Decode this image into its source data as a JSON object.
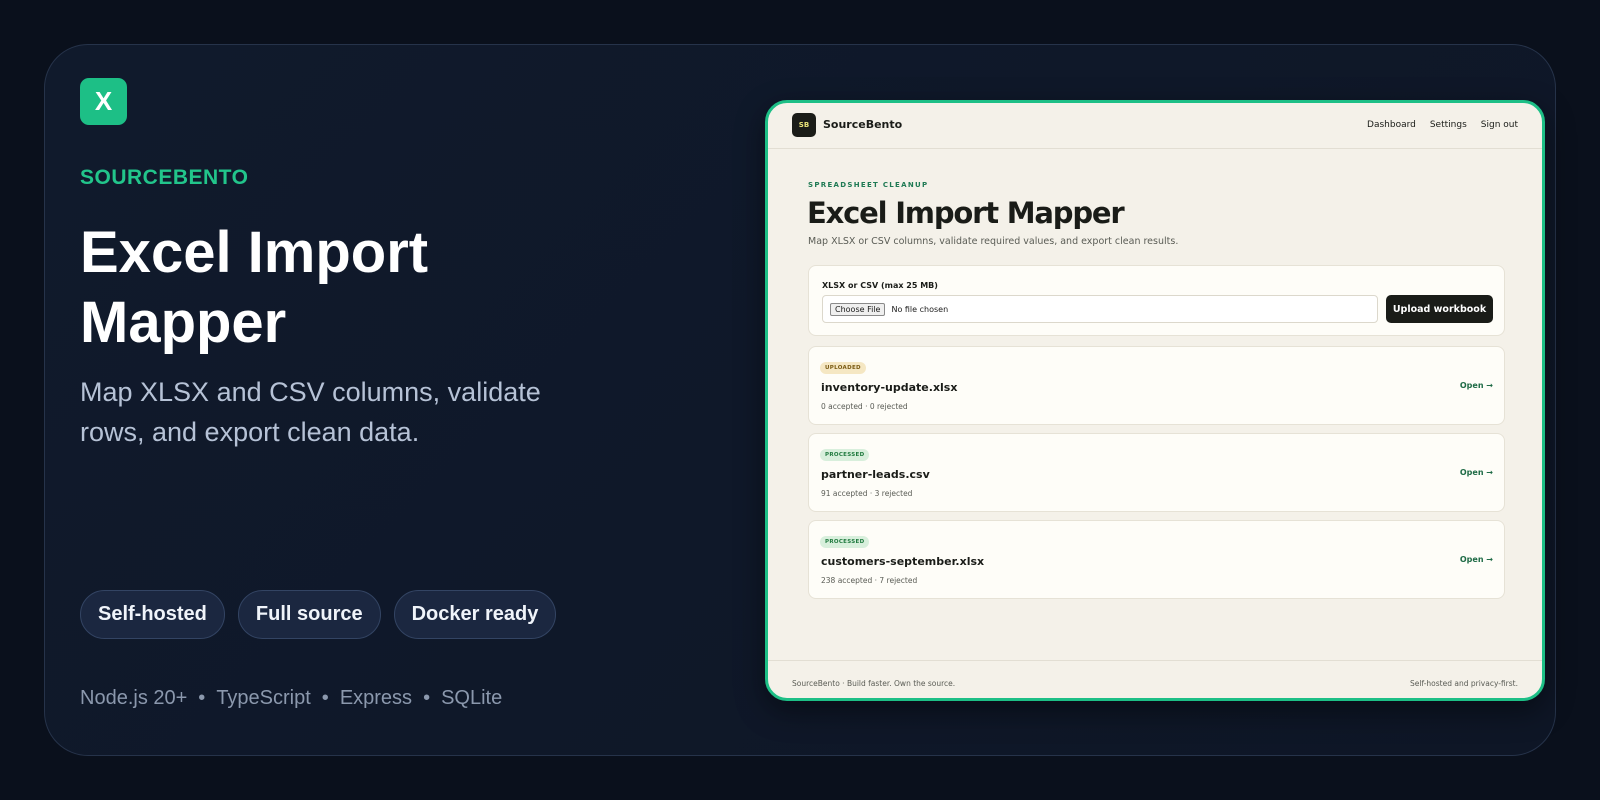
{
  "promo": {
    "logo_letter": "X",
    "brand": "SOURCEBENTO",
    "title": "Excel Import Mapper",
    "subtitle": "Map XLSX and CSV columns, validate rows, and export clean data.",
    "chips": [
      "Self-hosted",
      "Full source",
      "Docker ready"
    ],
    "stack": [
      "Node.js 20+",
      "TypeScript",
      "Express",
      "SQLite"
    ],
    "stack_separator": "•",
    "accent_color": "#22c58b"
  },
  "app": {
    "logo_text": "SB",
    "name": "SourceBento",
    "nav": [
      "Dashboard",
      "Settings",
      "Sign out"
    ],
    "eyebrow": "SPREADSHEET CLEANUP",
    "title": "Excel Import Mapper",
    "subtitle": "Map XLSX or CSV columns, validate required values, and export clean results.",
    "upload": {
      "label": "XLSX or CSV (max 25 MB)",
      "choose_label": "Choose File",
      "no_file": "No file chosen",
      "button": "Upload workbook"
    },
    "files": [
      {
        "status": "UPLOADED",
        "name": "inventory-update.xlsx",
        "stats": "0 accepted · 0 rejected",
        "open": "Open →"
      },
      {
        "status": "PROCESSED",
        "name": "partner-leads.csv",
        "stats": "91 accepted · 3 rejected",
        "open": "Open →"
      },
      {
        "status": "PROCESSED",
        "name": "customers-september.xlsx",
        "stats": "238 accepted · 7 rejected",
        "open": "Open →"
      }
    ],
    "footer_left": "SourceBento · Build faster. Own the source.",
    "footer_right": "Self-hosted and privacy-first."
  }
}
